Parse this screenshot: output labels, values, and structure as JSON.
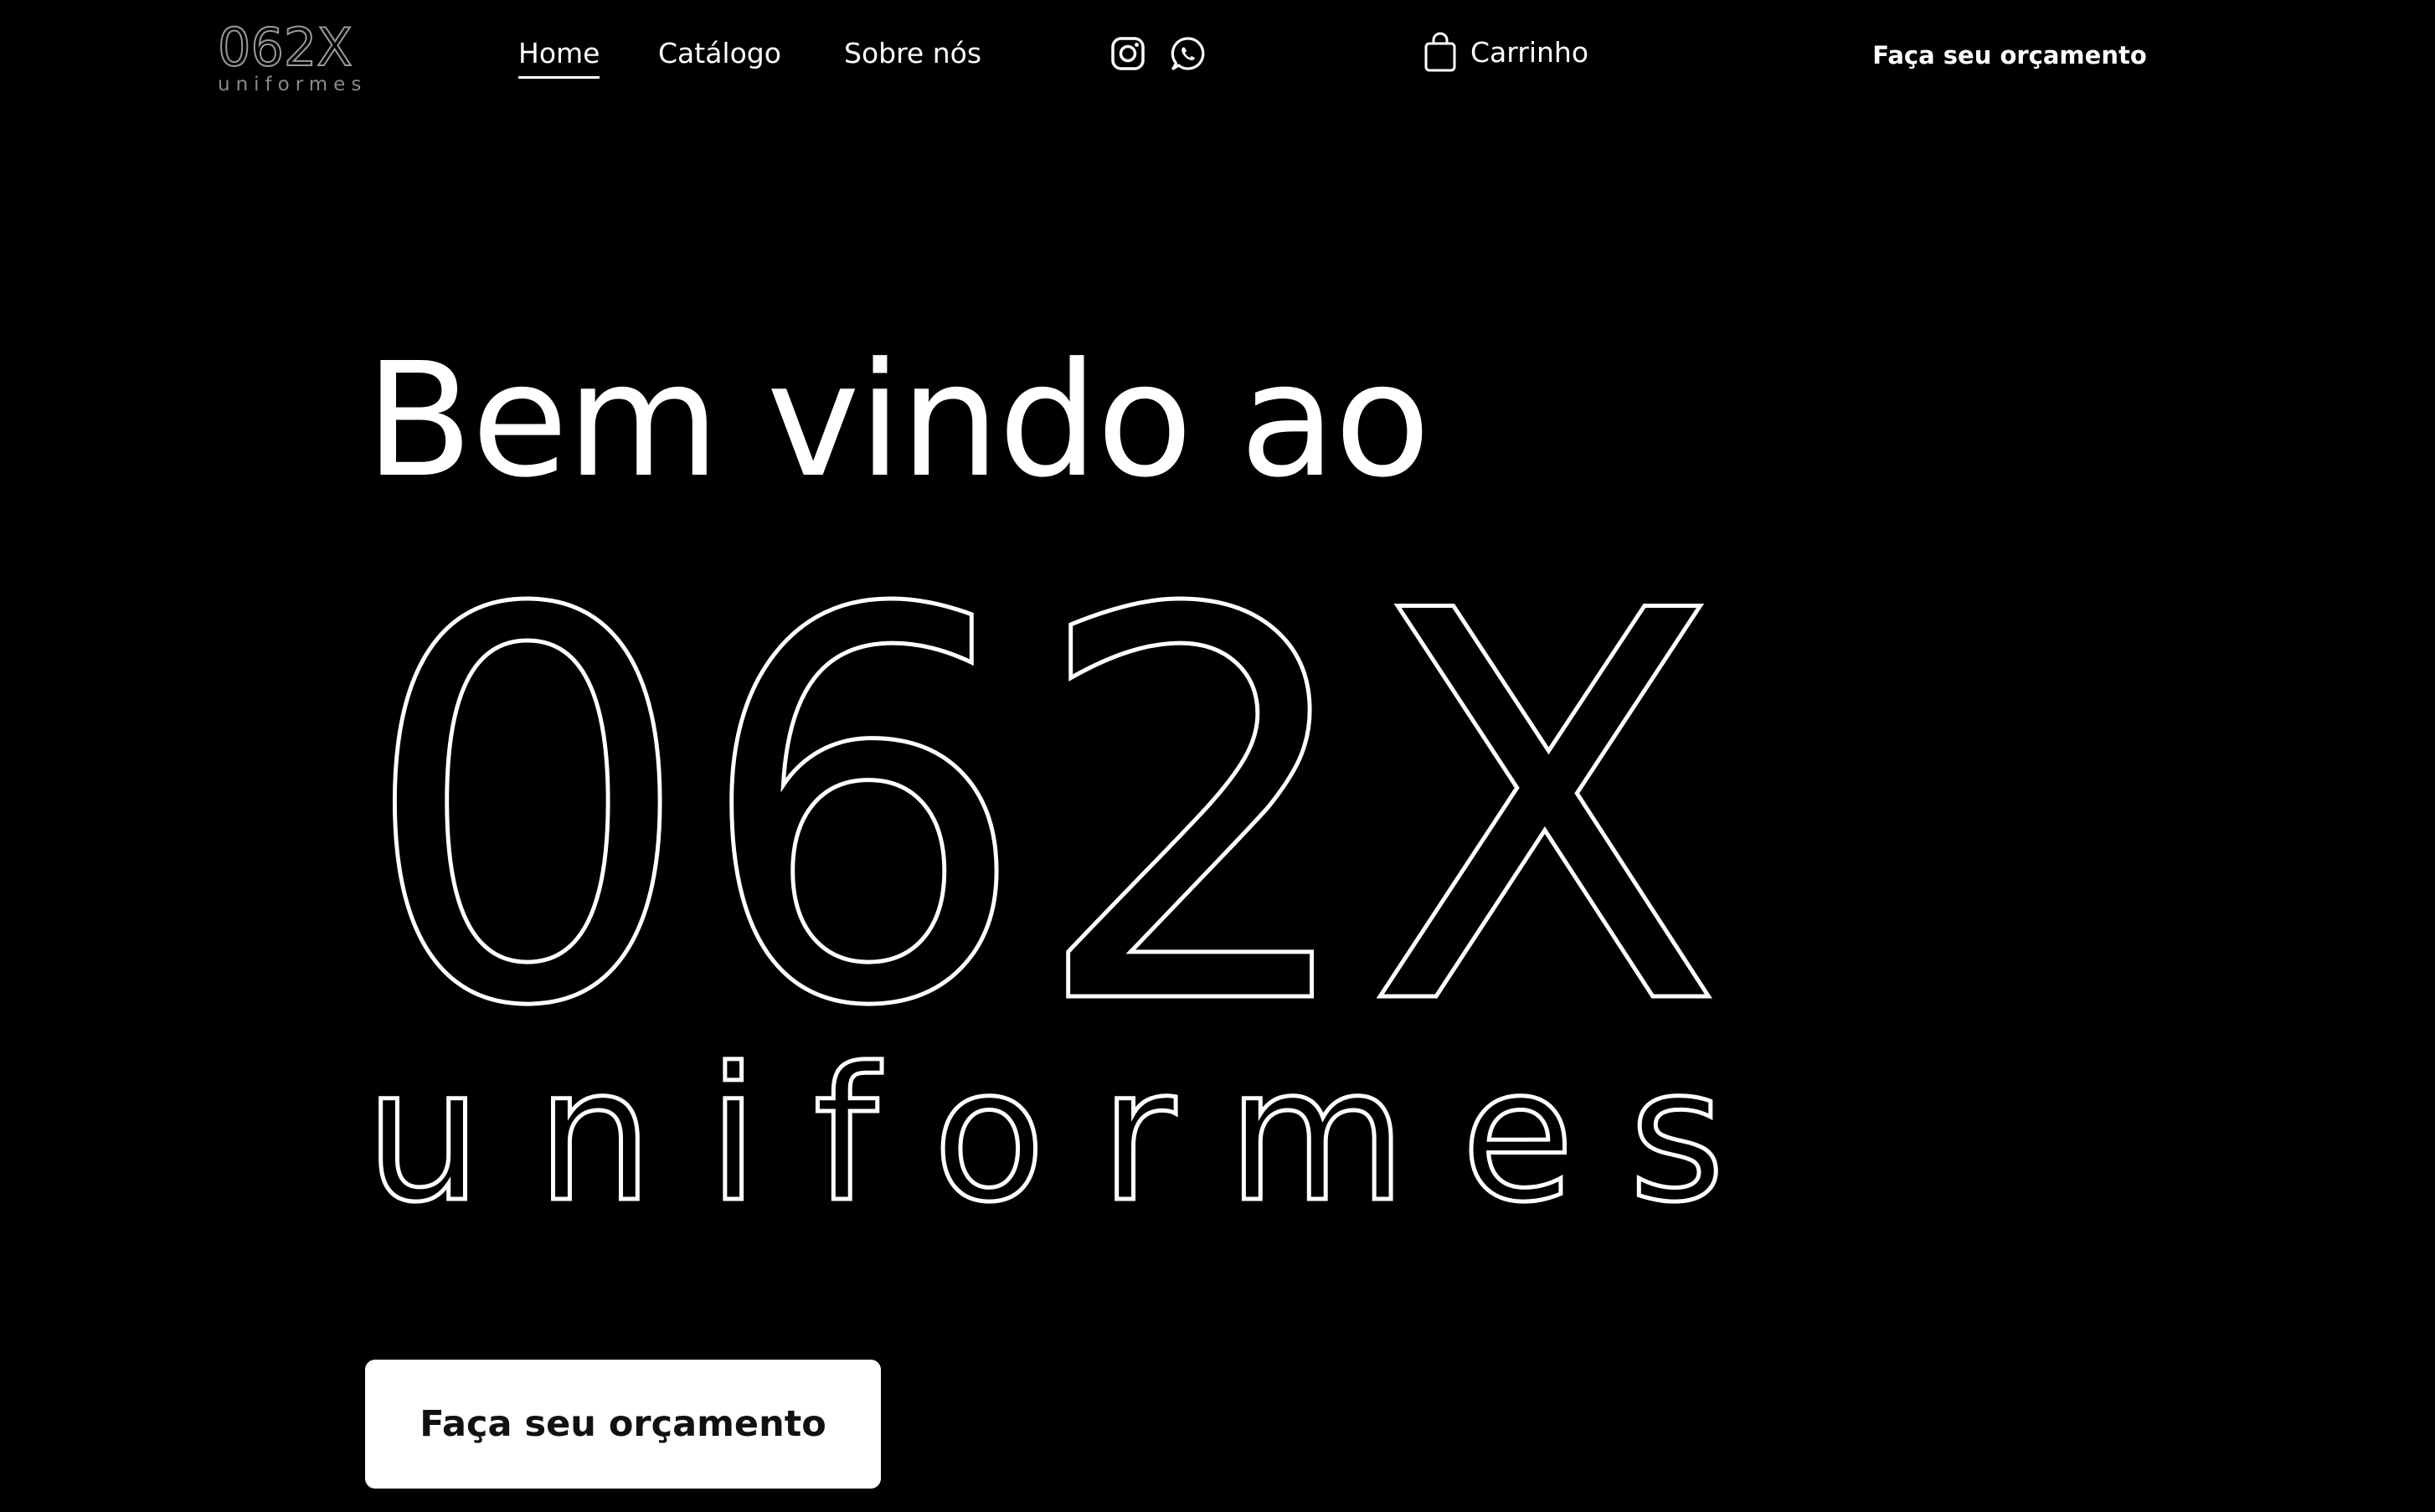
{
  "header": {
    "logo": {
      "main": "062X",
      "sub": "uniformes"
    },
    "nav": [
      {
        "label": "Home"
      },
      {
        "label": "Catálogo"
      },
      {
        "label": "Sobre nós"
      }
    ],
    "social_icons": [
      "instagram-icon",
      "whatsapp-icon"
    ],
    "cart_label": "Carrinho",
    "cart_icon": "shopping-bag-icon",
    "cta_label": "Faça seu orçamento"
  },
  "hero": {
    "welcome": "Bem vindo ao",
    "logo_main": "062X",
    "logo_sub": "uniformes",
    "cta_label": "Faça seu orçamento"
  },
  "colors": {
    "background": "#000000",
    "foreground": "#ffffff",
    "button_text": "#111111"
  }
}
